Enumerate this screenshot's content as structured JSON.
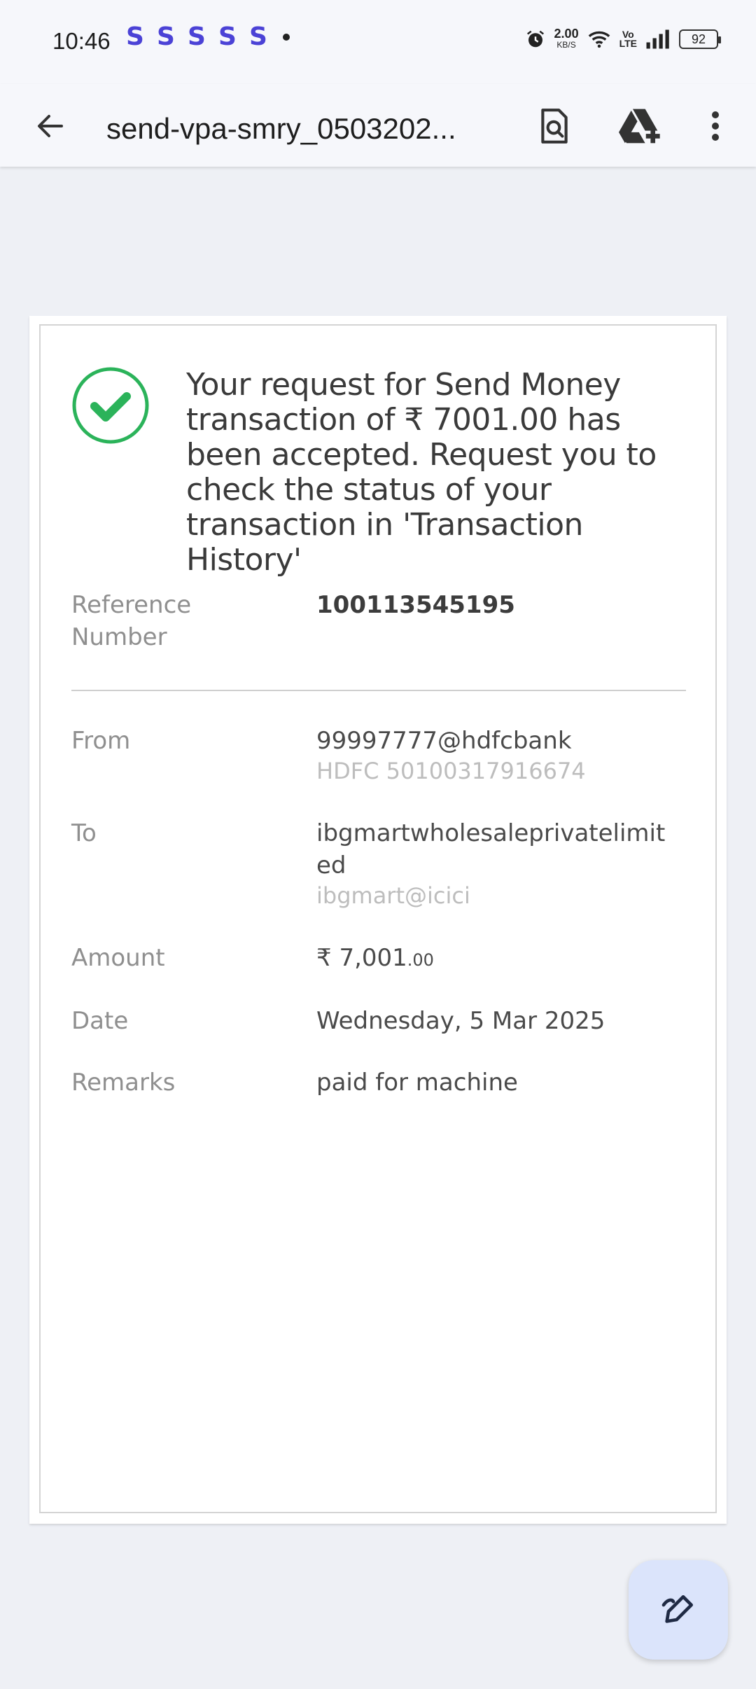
{
  "status_bar": {
    "time": "10:46",
    "app_icons": [
      "S",
      "S",
      "S",
      "S",
      "S"
    ],
    "net_speed": "2.00",
    "net_unit": "KB/S",
    "volte_top": "Vo",
    "volte_bottom": "LTE",
    "battery": "92"
  },
  "app_bar": {
    "title": "send-vpa-smry_0503202...",
    "back_icon": "arrow-back-icon",
    "actions": [
      "search-document-icon",
      "drive-add-icon",
      "more-vert-icon"
    ]
  },
  "document": {
    "message": "Your request for Send Money transaction of ₹ 7001.00 has been accepted. Request you to check the status of your transaction in 'Transaction History'",
    "reference_label": "Reference Number",
    "reference_value": "100113545195",
    "from_label": "From",
    "from_value": "99997777@hdfcbank",
    "from_sub": "HDFC 50100317916674",
    "to_label": "To",
    "to_value": "ibgmartwholesaleprivatelimited",
    "to_sub": "ibgmart@icici",
    "amount_label": "Amount",
    "amount_main": "₹ 7,001",
    "amount_decimal": ".00",
    "date_label": "Date",
    "date_value": "Wednesday, 5 Mar 2025",
    "remarks_label": "Remarks",
    "remarks_value": "paid for machine"
  },
  "colors": {
    "success_green": "#2bb35a",
    "app_icon_purple": "#4b42d6",
    "fab_background": "#dbe4fb"
  },
  "fab": {
    "icon": "edit-annotate-icon"
  }
}
